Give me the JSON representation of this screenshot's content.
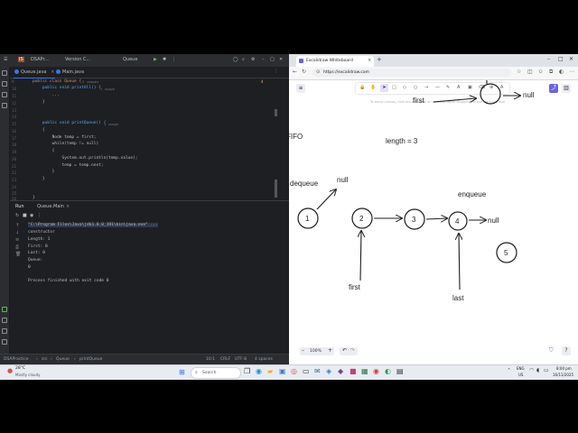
{
  "ide": {
    "title_project": "IS",
    "title_name": "DSAPr...",
    "title_vcs": "Version C...",
    "title_run": "Queue",
    "tabs": [
      "Queue.java",
      "Main.java"
    ],
    "code_lines": [
      {
        "num": "9",
        "text": "public class Queue {",
        "hint": "3 usages"
      },
      {
        "num": "10",
        "text": "    public void printAll() {",
        "hint": "1 usage"
      },
      {
        "num": "11",
        "text": "        ...",
        "hint": ""
      },
      {
        "num": "12",
        "text": "    }",
        "hint": ""
      },
      {
        "num": "13",
        "text": "",
        "hint": ""
      },
      {
        "num": "14",
        "text": "",
        "hint": ""
      },
      {
        "num": "15",
        "text": "    public void printQueue() {",
        "hint": "1 usage"
      },
      {
        "num": "16",
        "text": "    {",
        "hint": ""
      },
      {
        "num": "17",
        "text": "        Node temp = first;",
        "hint": ""
      },
      {
        "num": "18",
        "text": "        while(temp != null)",
        "hint": ""
      },
      {
        "num": "19",
        "text": "        {",
        "hint": ""
      },
      {
        "num": "20",
        "text": "            System.out.println(temp.value);",
        "hint": ""
      },
      {
        "num": "21",
        "text": "            temp = temp.next;",
        "hint": ""
      },
      {
        "num": "22",
        "text": "        }",
        "hint": ""
      },
      {
        "num": "23",
        "text": "    }",
        "hint": ""
      },
      {
        "num": "24",
        "text": "",
        "hint": ""
      },
      {
        "num": "25",
        "text": "",
        "hint": ""
      },
      {
        "num": "26",
        "text": "}",
        "hint": ""
      }
    ],
    "run_tab": "Run",
    "run_config": "Queue.Main",
    "console": [
      "\"C:\\Program Files\\Java\\jdk1.8.0_191\\bin\\java.exe\" ...",
      "constructor",
      "Length: 1",
      "First: 0",
      "Last: 0",
      "Queue:",
      "0",
      "",
      "Process finished with exit code 0"
    ],
    "breadcrumb": [
      "DSAPractice",
      "src",
      "Queue",
      "printQueue"
    ],
    "status": [
      "10:1",
      "CRLF",
      "UTF-8",
      "4 spaces"
    ],
    "warning_count": "4"
  },
  "browser": {
    "tab_title": "Excalidraw Whiteboard",
    "new_tab": "+",
    "url": "https://excalidraw.com",
    "canvas_hint": "To move canvas, hold mouse wheel or spacebar while dragging, or use the hand tool",
    "zoom": "100%",
    "labels": {
      "fifo": "FIFO",
      "length": "length = 3",
      "dequeue": "dequeue",
      "null_top": "null",
      "enqueue": "enqueue",
      "null_right": "null",
      "first_top": "first",
      "null_topright": "null",
      "first_bottom": "first",
      "last": "last"
    },
    "nodes": [
      "1",
      "2",
      "3",
      "4",
      "5"
    ]
  },
  "taskbar": {
    "weather_temp": "28°C",
    "weather_desc": "Mostly cloudy",
    "search": "Search",
    "lang": "ENG",
    "lang_sub": "US",
    "time": "8:00 pm",
    "date": "16/11/2025"
  },
  "colors": {
    "ide_bg": "#1e1f22",
    "taskbar_bg": "#e8ecf2",
    "accent": "#6965db",
    "ink": "#1e1e1e"
  }
}
